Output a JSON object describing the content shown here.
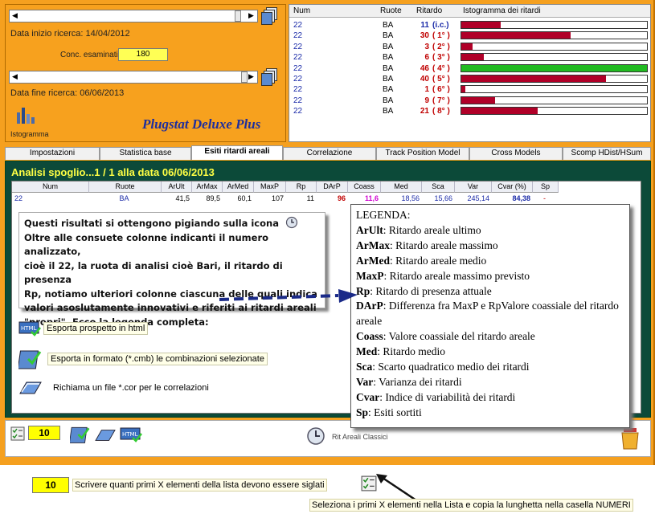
{
  "search": {
    "start_label": "Data inizio ricerca: 14/04/2012",
    "conc_label": "Conc. esaminati",
    "conc_value": "180",
    "end_label": "Data fine ricerca: 06/06/2013",
    "histo_label": "Istogramma"
  },
  "brand": "Plugstat Deluxe Plus",
  "grid": {
    "headers": [
      "Num",
      "Ruote",
      "Ritardo",
      "Istogramma dei ritardi"
    ],
    "rows": [
      {
        "num": "22",
        "ruota": "BA",
        "rit": "11",
        "pos": "(i.c.)",
        "fill": 0.21,
        "color": "#b00028"
      },
      {
        "num": "22",
        "ruota": "BA",
        "rit": "30",
        "pos": "( 1° )",
        "fill": 0.59,
        "color": "#b00028"
      },
      {
        "num": "22",
        "ruota": "BA",
        "rit": "3",
        "pos": "( 2° )",
        "fill": 0.06,
        "color": "#b00028"
      },
      {
        "num": "22",
        "ruota": "BA",
        "rit": "6",
        "pos": "( 3° )",
        "fill": 0.12,
        "color": "#b00028"
      },
      {
        "num": "22",
        "ruota": "BA",
        "rit": "46",
        "pos": "( 4° )",
        "fill": 1.0,
        "color": "#22bb22"
      },
      {
        "num": "22",
        "ruota": "BA",
        "rit": "40",
        "pos": "( 5° )",
        "fill": 0.78,
        "color": "#b00028"
      },
      {
        "num": "22",
        "ruota": "BA",
        "rit": "1",
        "pos": "( 6° )",
        "fill": 0.02,
        "color": "#b00028"
      },
      {
        "num": "22",
        "ruota": "BA",
        "rit": "9",
        "pos": "( 7° )",
        "fill": 0.18,
        "color": "#b00028"
      },
      {
        "num": "22",
        "ruota": "BA",
        "rit": "21",
        "pos": "( 8° )",
        "fill": 0.41,
        "color": "#b00028"
      }
    ]
  },
  "tabs": [
    "Impostazioni",
    "Statistica base",
    "Esiti ritardi areali",
    "Correlazione",
    "Track Position Model",
    "Cross Models",
    "Scomp HDist/HSum"
  ],
  "active_tab": 2,
  "main_title": "Analisi spoglio...1 / 1 alla data 06/06/2013",
  "table": {
    "headers": [
      "Num",
      "Ruote",
      "ArUlt",
      "ArMax",
      "ArMed",
      "MaxP",
      "Rp",
      "DArP",
      "Coass",
      "Med",
      "Sca",
      "Var",
      "Cvar (%)",
      "Sp"
    ],
    "row": [
      "22",
      "BA",
      "41,5",
      "89,5",
      "60,1",
      "107",
      "11",
      "96",
      "11,6",
      "18,56",
      "15,66",
      "245,14",
      "84,38",
      "-"
    ]
  },
  "note_lines": [
    "Questi risultati si ottengono pigiando sulla icona",
    "Oltre alle consuete colonne indicanti il numero analizzato,",
    "cioè il 22, la ruota di analisi cioè Bari, il ritardo di presenza",
    "Rp, notiamo ulteriori colonne ciascuna delle quali indica",
    "valori asoslutamente innovativi e riferiti ai ritardi areali",
    "\"propri\". Ecco la legenda completa:"
  ],
  "legend": {
    "title": "LEGENDA:",
    "items": [
      {
        "k": "ArUlt",
        "v": ": Ritardo areale ultimo"
      },
      {
        "k": "ArMax",
        "v": ": Ritardo areale massimo"
      },
      {
        "k": "ArMed",
        "v": ": Ritardo areale medio"
      },
      {
        "k": "MaxP",
        "v": ": Ritardo areale massimo previsto"
      },
      {
        "k": "Rp",
        "v": ": Ritardo di presenza attuale"
      },
      {
        "k": "DArP",
        "v": ": Differenza fra MaxP e RpValore coassiale del ritardo areale"
      },
      {
        "k": "Coass",
        "v": ": Valore coassiale del ritardo areale"
      },
      {
        "k": "Med",
        "v": ": Ritardo medio"
      },
      {
        "k": "Sca",
        "v": ": Scarto quadratico medio dei ritardi"
      },
      {
        "k": "Var",
        "v": ": Varianza dei ritardi"
      },
      {
        "k": "Cvar",
        "v": ": Indice di variabilità dei ritardi"
      },
      {
        "k": "Sp",
        "v": ": Esiti sortiti"
      }
    ]
  },
  "actions": {
    "html": "Esporta prospetto in html",
    "cmb": "Esporta in formato (*.cmb) le combinazioni selezionate",
    "cor": "Richiama un file *.cor per le correlazioni"
  },
  "toolbar": {
    "count": "10",
    "rit_label": "Rit Areali Classici"
  },
  "bottom": {
    "count": "10",
    "hint": "Scrivere quanti primi X elementi della lista devono essere siglati",
    "tip": "Seleziona i primi X elementi nella Lista e copia la lunghetta nella casella NUMERI"
  }
}
